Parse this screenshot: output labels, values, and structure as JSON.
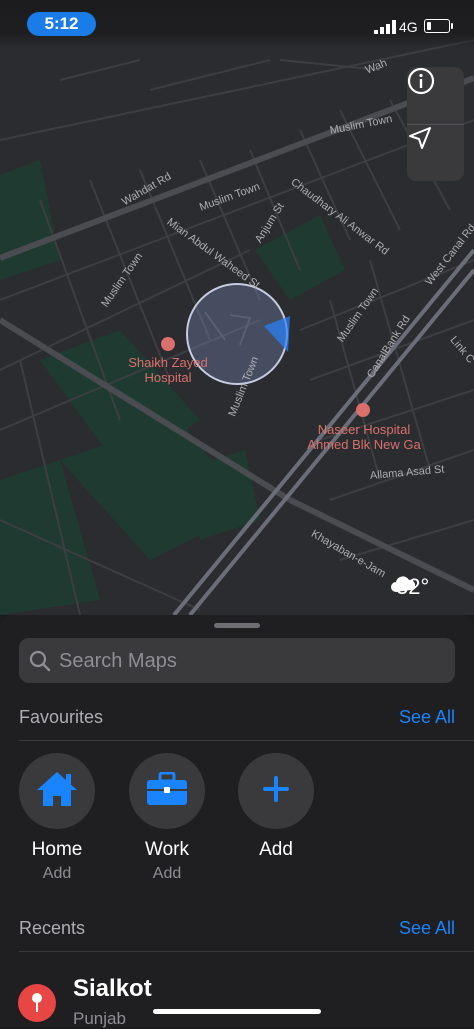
{
  "status_bar": {
    "time": "5:12",
    "network": "4G"
  },
  "map": {
    "road_labels": {
      "wahdat_rd": "Wahdat Rd",
      "muslim_town_1": "Muslim Town",
      "muslim_town_2": "Muslim Town",
      "muslim_town_3": "Muslim Town",
      "muslim_town_4": "Muslim Town",
      "muslim_town_5": "Muslim Town",
      "chaudhary": "Chaudhary Ali Anwar Rd",
      "mian_abdul": "Mian Abdul Waheed St",
      "anjum_st": "Anjum St",
      "west_canal": "West Canal Rd",
      "canalbank": "CanalBank Rd",
      "allama": "Allama Asad St",
      "khayaban": "Khayaban-e-Jam",
      "wah_top": "Wah",
      "link_c": "Link C"
    },
    "places": {
      "sheikh_zayed": "Shaikh Zayed\nHospital",
      "naseer": "Naseer Hospital\nAhmed Blk New Ga"
    },
    "weather": {
      "temperature": "32°",
      "icon": "cloud-icon"
    },
    "controls": [
      "info-icon",
      "location-arrow-icon"
    ]
  },
  "sheet": {
    "search": {
      "placeholder": "Search Maps"
    },
    "favourites": {
      "title": "Favourites",
      "see_all": "See All",
      "items": [
        {
          "title": "Home",
          "subtitle": "Add",
          "icon": "house-icon"
        },
        {
          "title": "Work",
          "subtitle": "Add",
          "icon": "briefcase-icon"
        },
        {
          "title": "Add",
          "subtitle": "",
          "icon": "plus-icon"
        }
      ]
    },
    "recents": {
      "title": "Recents",
      "see_all": "See All",
      "items": [
        {
          "title": "Sialkot",
          "subtitle": "Punjab",
          "icon": "pin-icon"
        }
      ]
    }
  },
  "colors": {
    "accent": "#1a84ff",
    "time_pill": "#1a7ce6",
    "map_bg": "#2b2c2f",
    "park": "#1f3a30",
    "pin": "#e84545",
    "place_label": "#d9706b"
  }
}
